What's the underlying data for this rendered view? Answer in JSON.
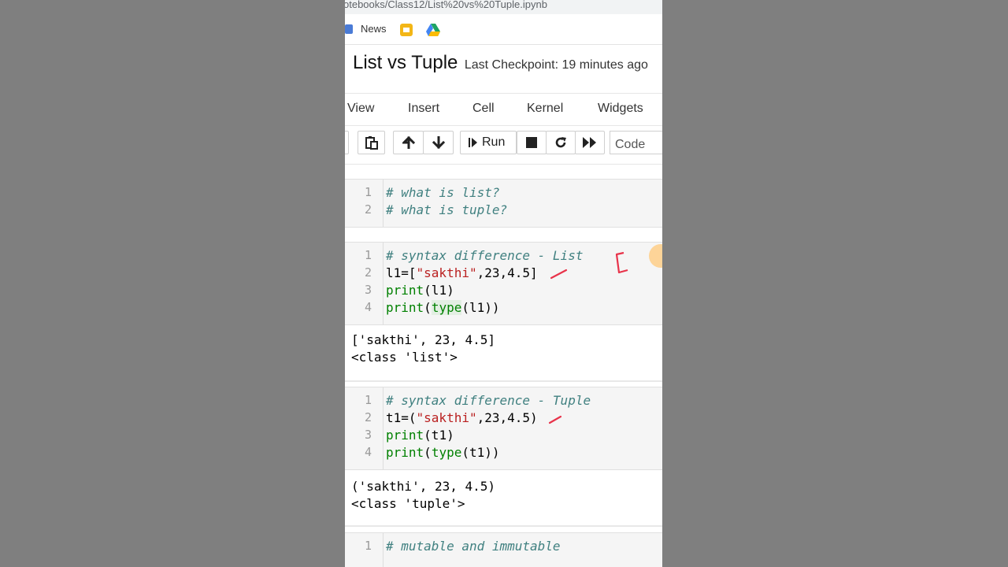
{
  "browser": {
    "url_fragment": "otebooks/Class12/List%20vs%20Tuple.ipynb",
    "bookmark_news": "News"
  },
  "header": {
    "notebook_name": "List vs Tuple",
    "checkpoint": "Last Checkpoint: 19 minutes ago"
  },
  "menu": [
    "View",
    "Insert",
    "Cell",
    "Kernel",
    "Widgets"
  ],
  "toolbar": {
    "run_label": "Run",
    "cell_type": "Code"
  },
  "cells": {
    "c1": {
      "lines": [
        "1",
        "2"
      ],
      "code": [
        "# what is list?",
        "# what is tuple?"
      ]
    },
    "c2": {
      "lines": [
        "1",
        "2",
        "3",
        "4"
      ],
      "comment": "# syntax difference - List",
      "assign_var": "l1=[",
      "assign_str": "\"sakthi\"",
      "assign_rest": ",23,4.5]",
      "print_kw": "print",
      "print_args": "(l1)",
      "print2_kw": "print",
      "print2_open": "(",
      "type_kw": "type",
      "print2_rest": "(l1))",
      "output": [
        "['sakthi', 23, 4.5]",
        "<class 'list'>"
      ]
    },
    "c3": {
      "lines": [
        "1",
        "2",
        "3",
        "4"
      ],
      "comment": "# syntax difference - Tuple",
      "assign_var": "t1=(",
      "assign_str": "\"sakthi\"",
      "assign_rest": ",23,4.5)",
      "print_kw": "print",
      "print_args": "(t1)",
      "print2_kw": "print",
      "print2_open": "(",
      "type_kw": "type",
      "print2_rest": "(t1))",
      "output": [
        "('sakthi', 23, 4.5)",
        "<class 'tuple'>"
      ]
    },
    "c4": {
      "lines": [
        "1"
      ],
      "code": [
        "# mutable and immutable"
      ]
    }
  },
  "colors": {
    "comment": "#408080",
    "keyword": "#008000",
    "string": "#ba2121",
    "annotation": "#e8334a"
  }
}
